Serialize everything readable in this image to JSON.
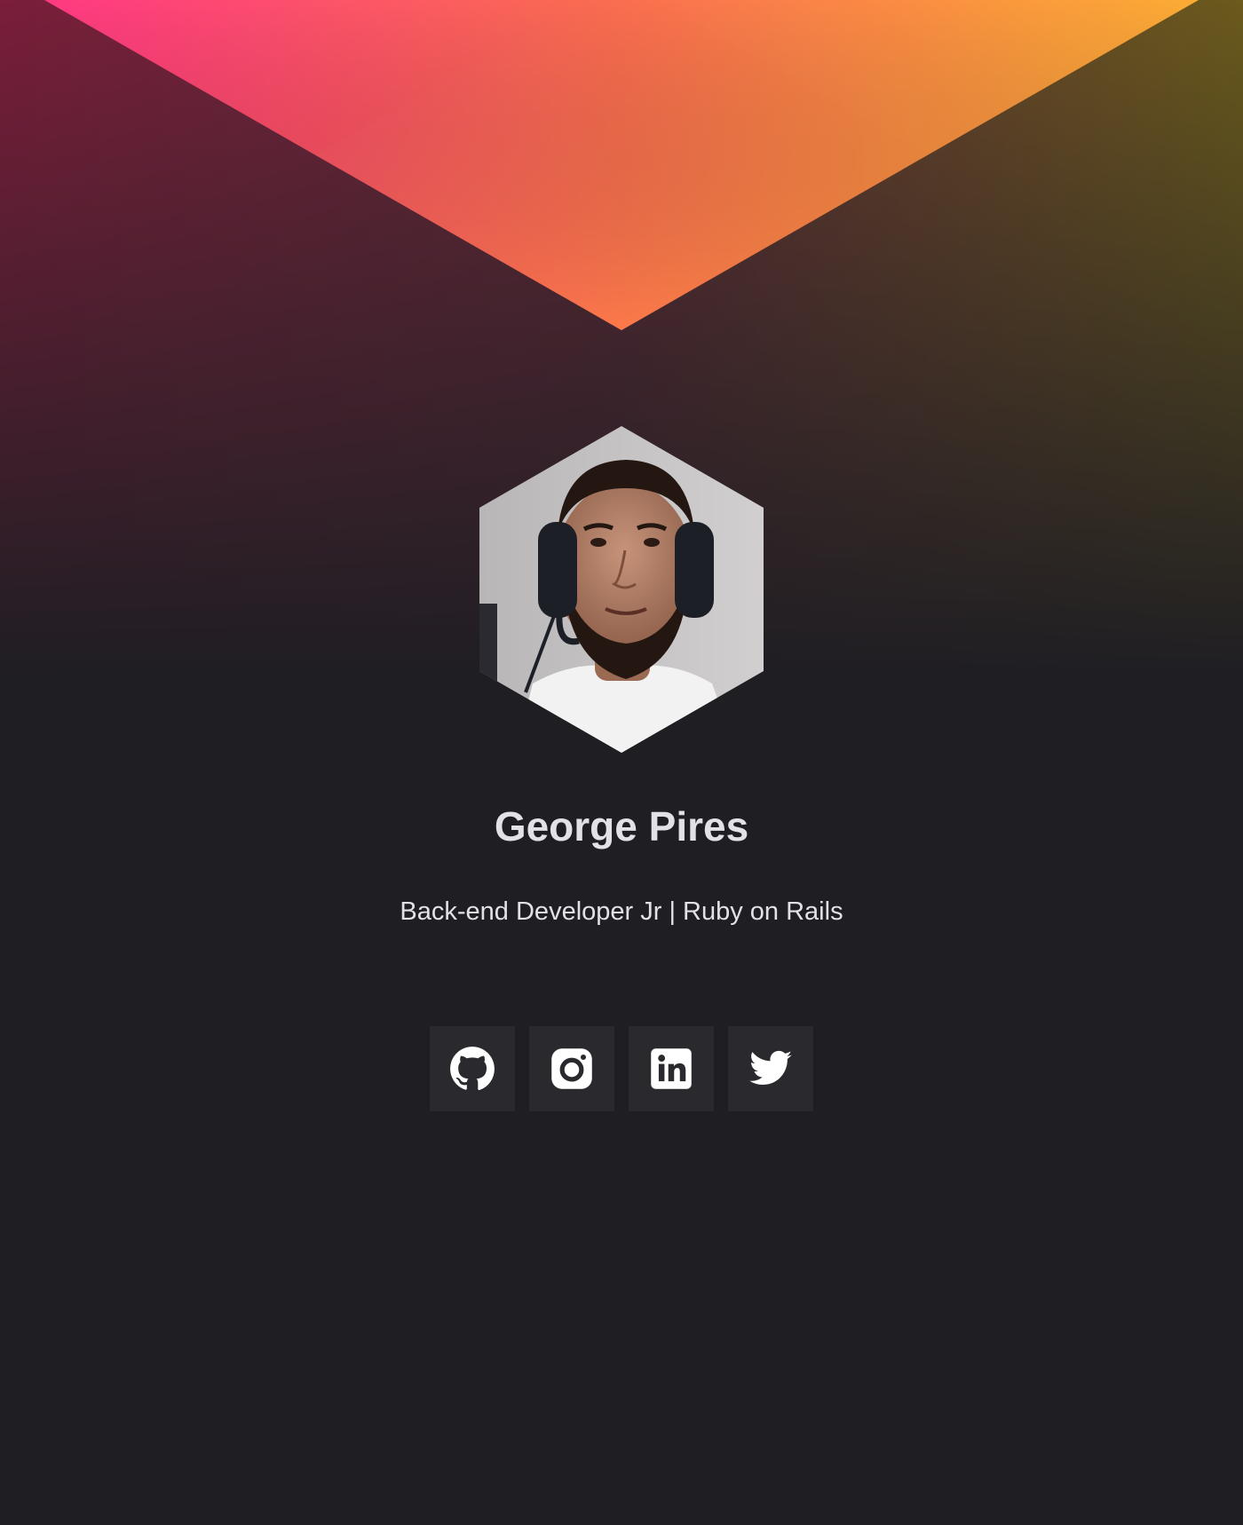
{
  "profile": {
    "name": "George Pires",
    "bio": "Back-end Developer Jr | Ruby on Rails"
  },
  "socials": [
    {
      "icon": "github-icon"
    },
    {
      "icon": "instagram-icon"
    },
    {
      "icon": "linkedin-icon"
    },
    {
      "icon": "twitter-icon"
    }
  ],
  "colors": {
    "background": "#1f1e23",
    "accent_pink": "#ff2d7a",
    "accent_orange": "#fb923c",
    "accent_yellow": "#fba92c",
    "text": "#e1e1e6",
    "button_bg": "#29292e"
  }
}
